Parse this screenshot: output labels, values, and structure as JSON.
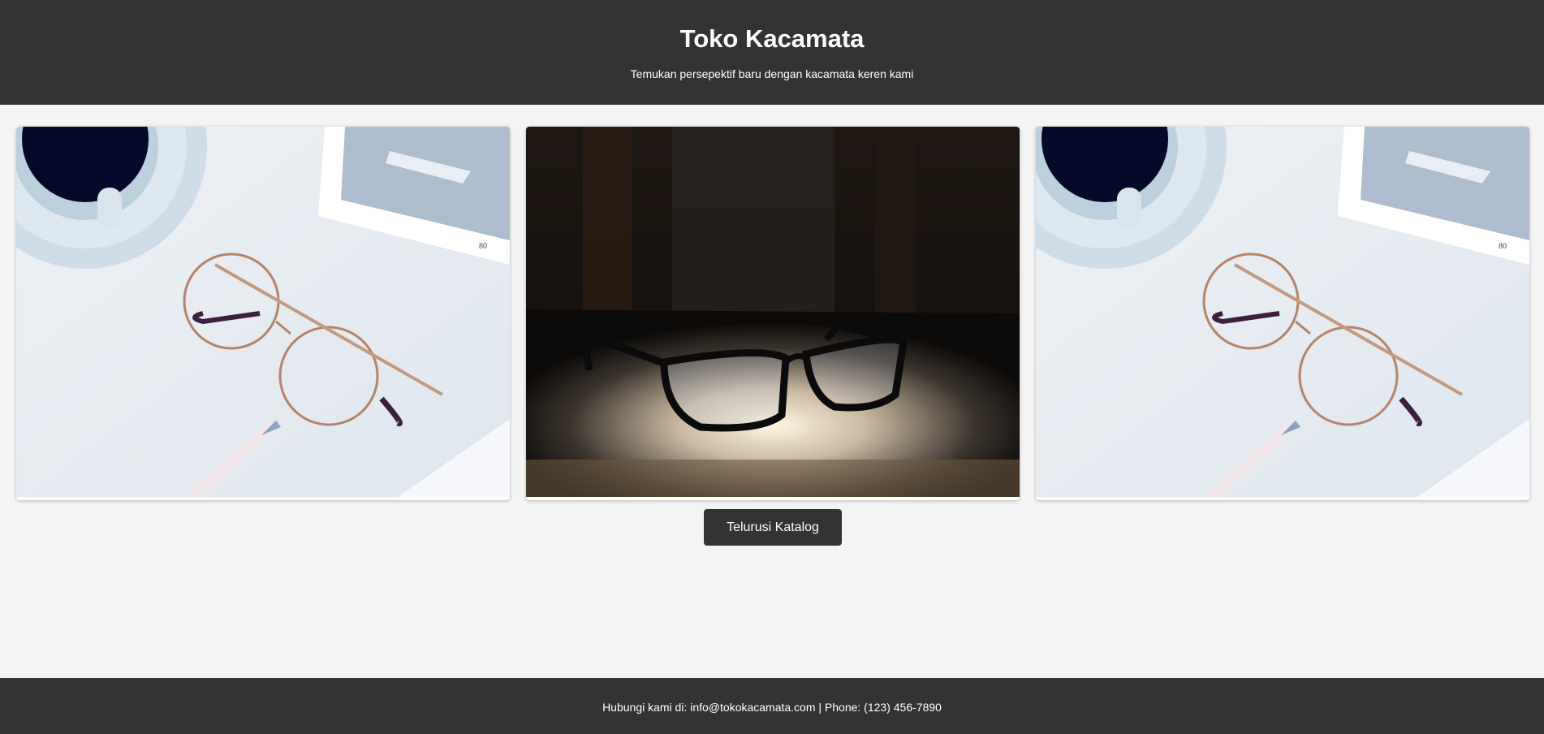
{
  "header": {
    "title": "Toko Kacamata",
    "tagline": "Temukan persepektif baru dengan kacamata keren kami"
  },
  "gallery": {
    "items": [
      {
        "image": "round-glasses-on-desk-photo",
        "icon": "photo"
      },
      {
        "image": "black-glasses-in-spotlight-photo",
        "icon": "photo"
      },
      {
        "image": "round-glasses-on-desk-photo",
        "icon": "photo"
      }
    ]
  },
  "catalog_button": {
    "label": "Telurusi Katalog"
  },
  "footer": {
    "contact": "Hubungi kami di: info@tokokacamata.com | Phone: (123) 456-7890"
  },
  "colors": {
    "header_bg": "#333333",
    "page_bg": "#f4f4f4",
    "button_bg": "#333333",
    "text_light": "#ffffff"
  }
}
